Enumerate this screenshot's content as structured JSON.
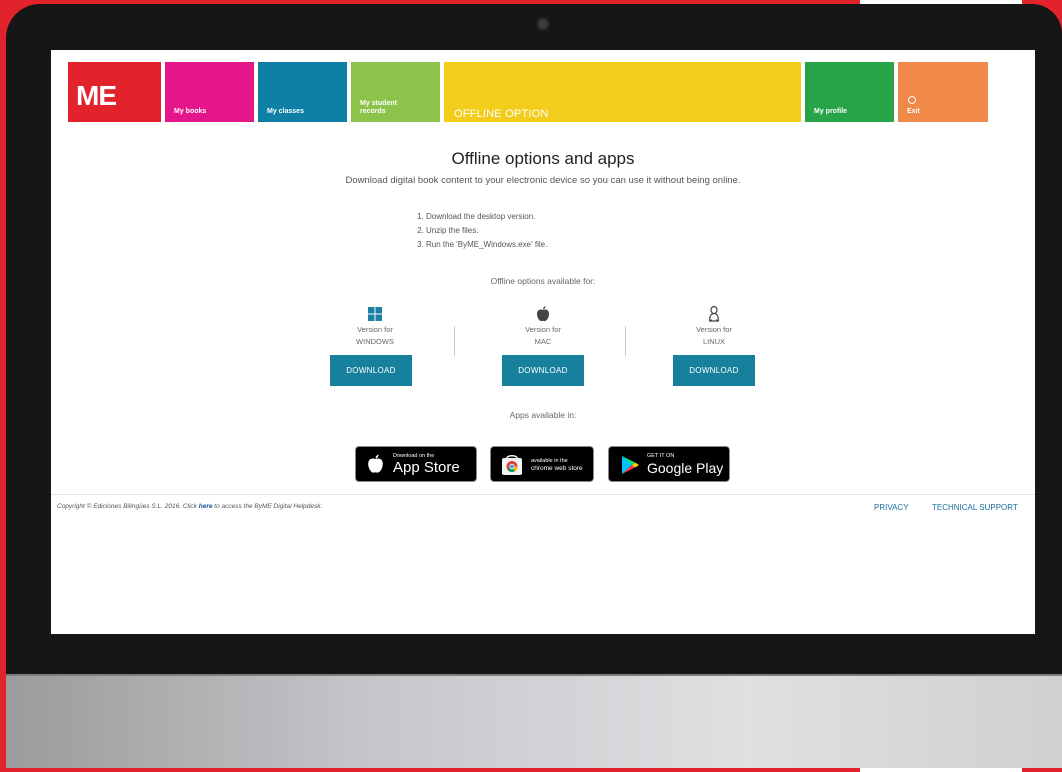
{
  "nav": {
    "logo": "ME",
    "tiles": [
      {
        "label": "My books",
        "color": "#e5168a"
      },
      {
        "label": "My classes",
        "color": "#0f80a5"
      },
      {
        "label": "My student records",
        "color": "#8cc34a"
      },
      {
        "label": "OFFLINE OPTION",
        "color": "#f3cd1c"
      },
      {
        "label": "My profile",
        "color": "#27a348"
      },
      {
        "label": "Exit",
        "color": "#f0884a"
      }
    ]
  },
  "main": {
    "title": "Offline options and apps",
    "subtitle": "Download digital book content to your electronic device so you can use it without being online.",
    "steps": [
      "Download the desktop version.",
      "Unzip the files.",
      "Run the 'ByME_Windows.exe' file."
    ],
    "available_for": "Offline options available for:",
    "platforms": [
      {
        "icon": "windows-icon",
        "line1": "Version for",
        "line2": "WINDOWS",
        "button": "DOWNLOAD"
      },
      {
        "icon": "apple-icon",
        "line1": "Version for",
        "line2": "MAC",
        "button": "DOWNLOAD"
      },
      {
        "icon": "linux-icon",
        "line1": "Version for",
        "line2": "LINUX",
        "button": "DOWNLOAD"
      }
    ],
    "apps_label": "Apps available in:",
    "stores": [
      {
        "icon": "apple-icon",
        "small": "Download on the",
        "big": "App Store"
      },
      {
        "icon": "chrome-web-store-icon",
        "small": "available in the",
        "big": "chrome web store"
      },
      {
        "icon": "google-play-icon",
        "small": "GET IT ON",
        "big": "Google Play"
      }
    ]
  },
  "footer": {
    "copyright_pre": "Copyright © Ediciones Bilingües S.L. 2016. Click",
    "copyright_link": "here",
    "copyright_post": "to access the ByME Digital Helpdesk.",
    "privacy": "PRIVACY",
    "support": "TECHNICAL SUPPORT"
  },
  "colors": {
    "brand_red": "#e2232b",
    "button_blue": "#17809d"
  }
}
